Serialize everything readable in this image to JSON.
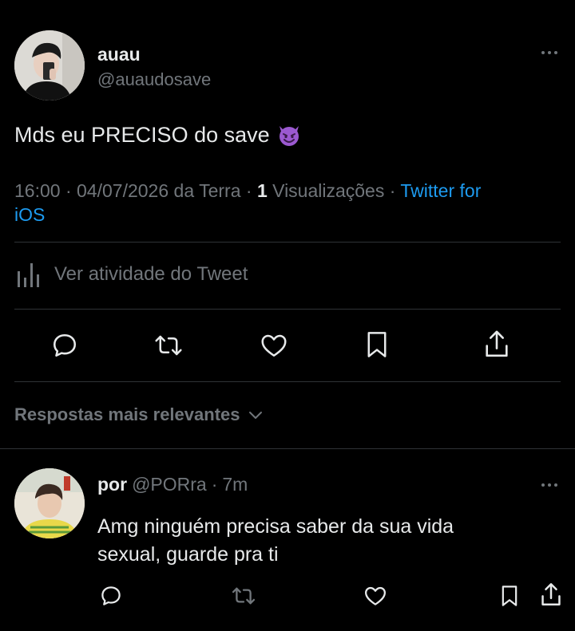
{
  "tweet": {
    "author_name": "auau",
    "author_handle": "@auaudosave",
    "text": "Mds eu PRECISO do save",
    "emoji": "😈",
    "time": "16:00",
    "date": "04/07/2026",
    "location": "da Terra",
    "views_count": "1",
    "views_label": "Visualizações",
    "source_line1": "Twitter for",
    "source_line2": "iOS",
    "sep": "·"
  },
  "activity": {
    "label": "Ver atividade do Tweet"
  },
  "actions": [
    "reply-icon",
    "retweet-icon",
    "like-icon",
    "bookmark-icon",
    "share-icon"
  ],
  "replies_sort": {
    "label": "Respostas mais relevantes"
  },
  "reply": {
    "author_name": "por",
    "author_handle": "@PORra",
    "sep": "·",
    "time_ago": "7m",
    "text_line1": "Amg ninguém precisa saber da sua vida",
    "text_line2": "sexual, guarde pra ti"
  },
  "colors": {
    "background": "#000000",
    "text": "#e7e9ea",
    "secondary": "#71767b",
    "link": "#1d9bf0",
    "divider": "#2f3336"
  }
}
